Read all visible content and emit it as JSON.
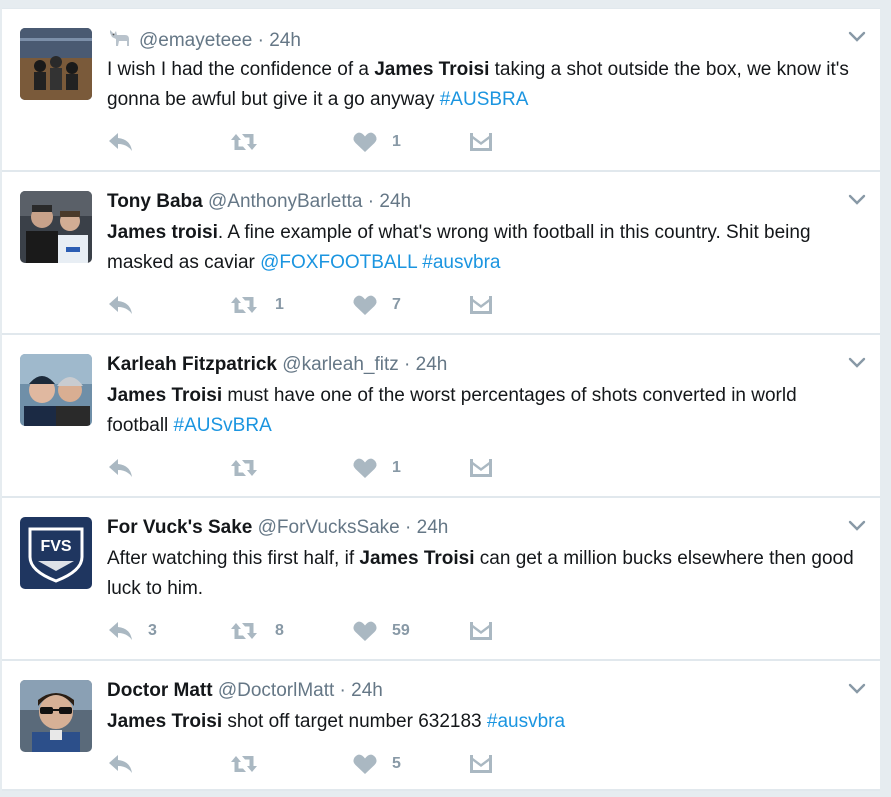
{
  "colors": {
    "link": "#1b95e0",
    "muted": "#657786",
    "icon": "#aab8c2",
    "count": "#8899a6"
  },
  "tweets": [
    {
      "fullname": "",
      "username": "@emayeteee",
      "sep": "·",
      "time": "24h",
      "has_goat_icon": true,
      "text": [
        {
          "t": "I wish I had the confidence of a ",
          "s": "plain"
        },
        {
          "t": "James Troisi",
          "s": "bold"
        },
        {
          "t": " taking a shot outside the box, we know it's gonna be awful but give it a go anyway ",
          "s": "plain"
        },
        {
          "t": "#AUSBRA",
          "s": "link"
        }
      ],
      "replies": "",
      "retweets": "",
      "likes": "1"
    },
    {
      "fullname": "Tony Baba",
      "username": "@AnthonyBarletta",
      "sep": "·",
      "time": "24h",
      "has_goat_icon": false,
      "text": [
        {
          "t": "James troisi",
          "s": "bold"
        },
        {
          "t": ". A fine example of what's wrong with football in this country. Shit being masked as caviar ",
          "s": "plain"
        },
        {
          "t": "@FOXFOOTBALL",
          "s": "link"
        },
        {
          "t": " ",
          "s": "plain"
        },
        {
          "t": "#ausvbra",
          "s": "link"
        }
      ],
      "replies": "",
      "retweets": "1",
      "likes": "7"
    },
    {
      "fullname": "Karleah Fitzpatrick",
      "username": "@karleah_fitz",
      "sep": "·",
      "time": "24h",
      "has_goat_icon": false,
      "text": [
        {
          "t": "James Troisi",
          "s": "bold"
        },
        {
          "t": " must have one of the worst percentages of shots converted in world football ",
          "s": "plain"
        },
        {
          "t": "#AUSvBRA",
          "s": "link"
        }
      ],
      "replies": "",
      "retweets": "",
      "likes": "1"
    },
    {
      "fullname": "For Vuck's Sake",
      "username": "@ForVucksSake",
      "sep": "·",
      "time": "24h",
      "has_goat_icon": false,
      "avatar_logo_text": "FVS",
      "text": [
        {
          "t": "After watching this first half, if ",
          "s": "plain"
        },
        {
          "t": "James Troisi",
          "s": "bold"
        },
        {
          "t": " can get a million bucks elsewhere then good luck to him.",
          "s": "plain"
        }
      ],
      "replies": "3",
      "retweets": "8",
      "likes": "59"
    },
    {
      "fullname": "Doctor Matt",
      "username": "@DoctorlMatt",
      "sep": "·",
      "time": "24h",
      "has_goat_icon": false,
      "text": [
        {
          "t": "James Troisi",
          "s": "bold"
        },
        {
          "t": " shot off target number 632183 ",
          "s": "plain"
        },
        {
          "t": "#ausvbra",
          "s": "link"
        }
      ],
      "replies": "",
      "retweets": "",
      "likes": "5"
    }
  ]
}
